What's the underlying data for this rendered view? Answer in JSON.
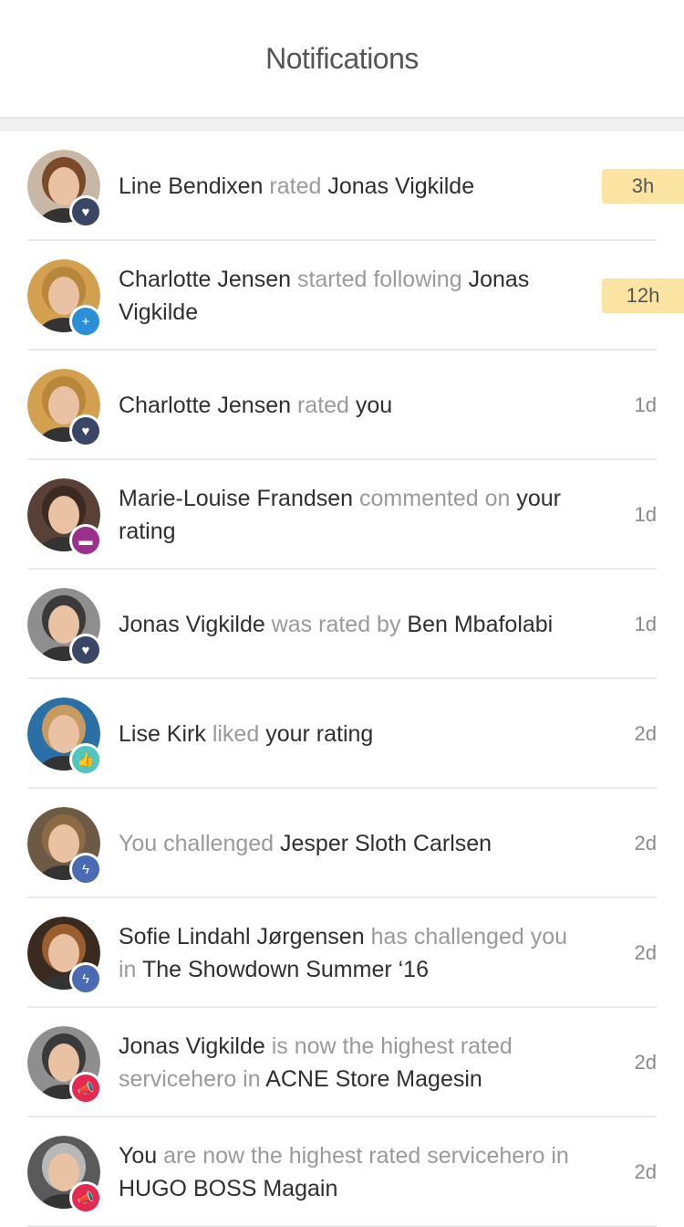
{
  "header": {
    "title": "Notifications"
  },
  "notifications": [
    {
      "parts": [
        [
          "Line Bendixen",
          "name"
        ],
        [
          " rated ",
          "verb"
        ],
        [
          "Jonas Vigkilde",
          "name"
        ]
      ],
      "time": "3h",
      "new": true,
      "badge": "heart",
      "badgeColor": "#3b4566",
      "avatarBg": "#c9b7a6",
      "hair": "#7a4a2a"
    },
    {
      "parts": [
        [
          "Charlotte Jensen",
          "name"
        ],
        [
          " started following ",
          "verb"
        ],
        [
          "Jonas Vigkilde",
          "name"
        ]
      ],
      "time": "12h",
      "new": true,
      "badge": "plus",
      "badgeColor": "#2b8fd6",
      "avatarBg": "#d2a04e",
      "hair": "#b9873c"
    },
    {
      "parts": [
        [
          "Charlotte Jensen",
          "name"
        ],
        [
          " rated ",
          "verb"
        ],
        [
          "you",
          "name"
        ]
      ],
      "time": "1d",
      "new": false,
      "badge": "heart",
      "badgeColor": "#3b4566",
      "avatarBg": "#d2a04e",
      "hair": "#b9873c"
    },
    {
      "parts": [
        [
          "Marie-Louise Frandsen",
          "name"
        ],
        [
          " commented on ",
          "verb"
        ],
        [
          "your rating",
          "name"
        ]
      ],
      "time": "1d",
      "new": false,
      "badge": "comment",
      "badgeColor": "#9a2f8e",
      "avatarBg": "#5a4137",
      "hair": "#3a2a22"
    },
    {
      "parts": [
        [
          "Jonas Vigkilde",
          "name"
        ],
        [
          " was rated by ",
          "verb"
        ],
        [
          "Ben Mbafolabi",
          "name"
        ]
      ],
      "time": "1d",
      "new": false,
      "badge": "heart",
      "badgeColor": "#3b4566",
      "avatarBg": "#8e8e8e",
      "hair": "#3a3a3a"
    },
    {
      "parts": [
        [
          "Lise Kirk",
          "name"
        ],
        [
          " liked ",
          "verb"
        ],
        [
          "your rating",
          "name"
        ]
      ],
      "time": "2d",
      "new": false,
      "badge": "thumb",
      "badgeColor": "#52c5bf",
      "avatarBg": "#2a6fa6",
      "hair": "#c99a60"
    },
    {
      "parts": [
        [
          "You challenged ",
          "verb"
        ],
        [
          "Jesper Sloth Carlsen",
          "name"
        ]
      ],
      "time": "2d",
      "new": false,
      "badge": "bolt",
      "badgeColor": "#4a6bb3",
      "avatarBg": "#6d5a44",
      "hair": "#8b6a44"
    },
    {
      "parts": [
        [
          "Sofie Lindahl Jørgensen",
          "name"
        ],
        [
          " has challenged you in ",
          "verb"
        ],
        [
          "The Showdown Summer ‘16",
          "name"
        ]
      ],
      "time": "2d",
      "new": false,
      "badge": "bolt",
      "badgeColor": "#4a6bb3",
      "avatarBg": "#3a2a20",
      "hair": "#9b5e2e"
    },
    {
      "parts": [
        [
          "Jonas Vigkilde",
          "name"
        ],
        [
          " is now the highest rated servicehero in ",
          "verb"
        ],
        [
          "ACNE Store Magesin",
          "name"
        ]
      ],
      "time": "2d",
      "new": false,
      "badge": "megaphone",
      "badgeColor": "#e5284f",
      "avatarBg": "#8e8e8e",
      "hair": "#3a3a3a"
    },
    {
      "parts": [
        [
          "You",
          "name"
        ],
        [
          " are now the highest rated servicehero in ",
          "verb"
        ],
        [
          "HUGO BOSS Magain",
          "name"
        ]
      ],
      "time": "2d",
      "new": false,
      "badge": "megaphone",
      "badgeColor": "#e5284f",
      "avatarBg": "#5a5a5a",
      "hair": "#b8b8b8"
    }
  ],
  "badge_icons": {
    "heart": "♥",
    "plus": "+",
    "comment": "▬",
    "thumb": "👍",
    "bolt": "ϟ",
    "megaphone": "📣"
  }
}
